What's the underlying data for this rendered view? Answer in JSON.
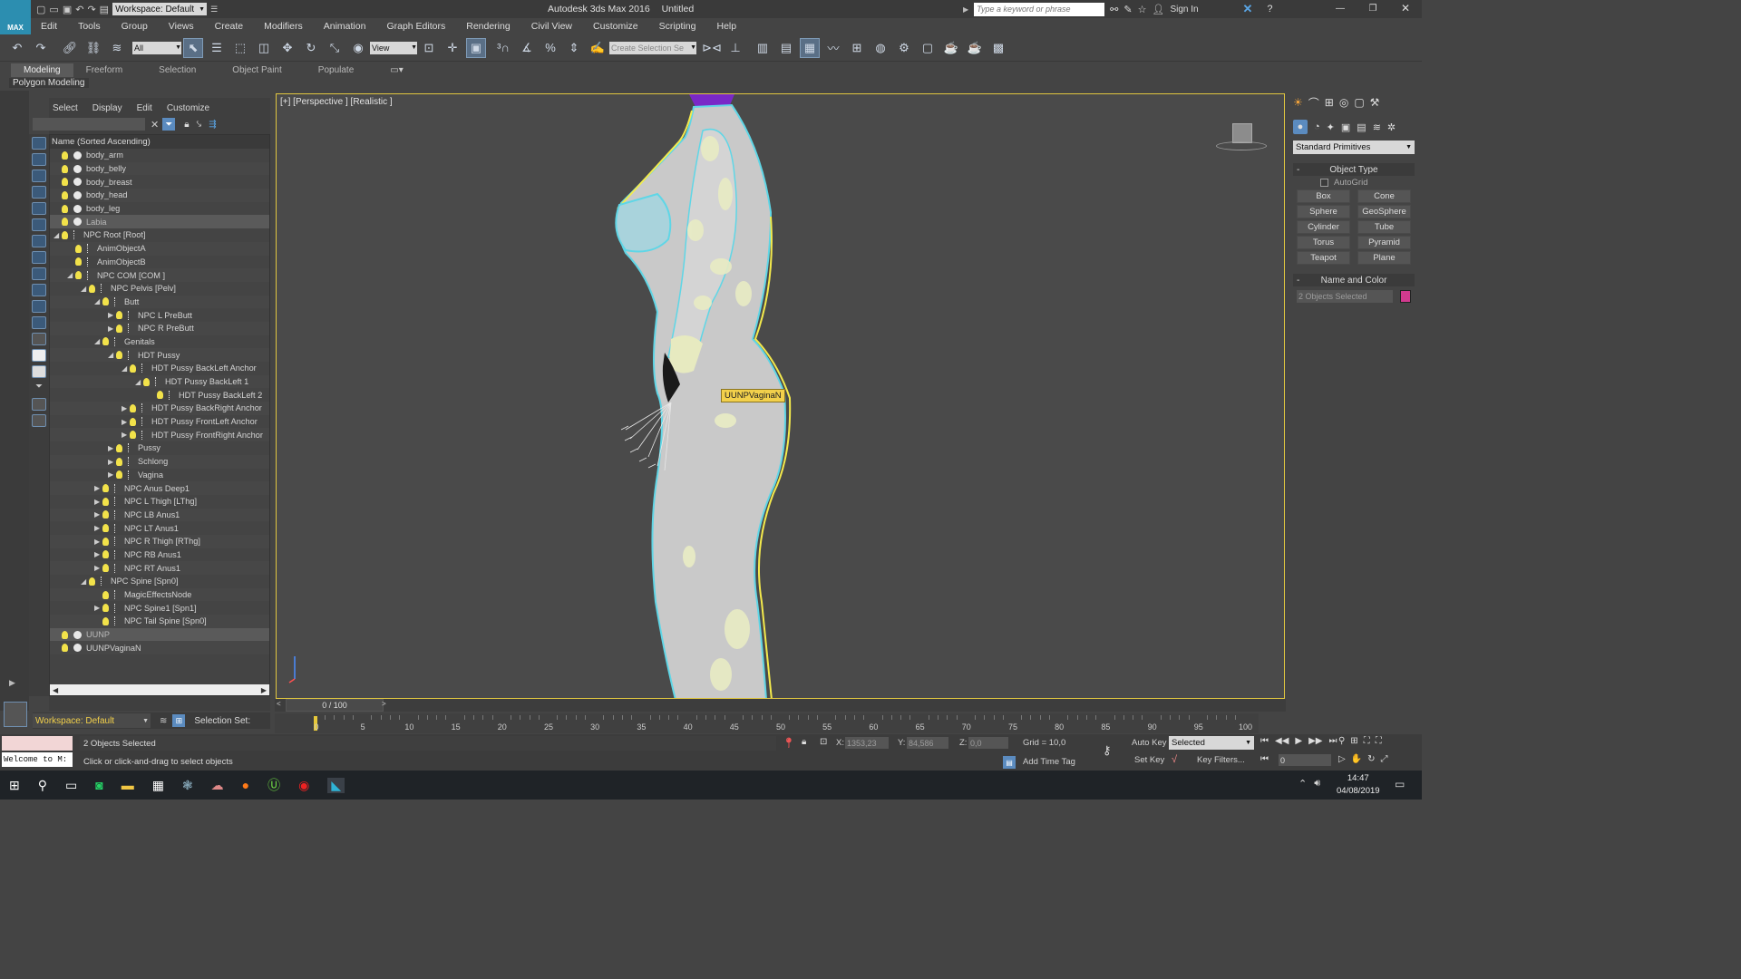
{
  "titlebar": {
    "app_logo": "MAX",
    "workspace": "Workspace: Default",
    "title": "Autodesk 3ds Max 2016",
    "document": "Untitled",
    "search_placeholder": "Type a keyword or phrase",
    "sign_in": "Sign In"
  },
  "menu": [
    "Edit",
    "Tools",
    "Group",
    "Views",
    "Create",
    "Modifiers",
    "Animation",
    "Graph Editors",
    "Rendering",
    "Civil View",
    "Customize",
    "Scripting",
    "Help"
  ],
  "toolbar": {
    "selection_filter": "All",
    "ref_coord": "View",
    "named_selection_placeholder": "Create Selection Se"
  },
  "ribbon": {
    "tabs": [
      "Modeling",
      "Freeform",
      "Selection",
      "Object Paint",
      "Populate"
    ],
    "active_tab": "Modeling",
    "panel": "Polygon Modeling"
  },
  "scene_explorer": {
    "menu": [
      "Select",
      "Display",
      "Edit",
      "Customize"
    ],
    "column_header": "Name (Sorted Ascending)",
    "rows": [
      {
        "label": "body_arm",
        "indent": 0,
        "type": "mesh",
        "expander": "",
        "selected": false
      },
      {
        "label": "body_belly",
        "indent": 0,
        "type": "mesh",
        "expander": "",
        "selected": false
      },
      {
        "label": "body_breast",
        "indent": 0,
        "type": "mesh",
        "expander": "",
        "selected": false
      },
      {
        "label": "body_head",
        "indent": 0,
        "type": "mesh",
        "expander": "",
        "selected": false
      },
      {
        "label": "body_leg",
        "indent": 0,
        "type": "mesh",
        "expander": "",
        "selected": false
      },
      {
        "label": "Labia",
        "indent": 0,
        "type": "mesh",
        "expander": "",
        "selected": true
      },
      {
        "label": "NPC Root [Root]",
        "indent": 0,
        "type": "bone",
        "expander": "open",
        "selected": false
      },
      {
        "label": "AnimObjectA",
        "indent": 1,
        "type": "bone",
        "expander": "",
        "selected": false
      },
      {
        "label": "AnimObjectB",
        "indent": 1,
        "type": "bone",
        "expander": "",
        "selected": false
      },
      {
        "label": "NPC COM [COM ]",
        "indent": 1,
        "type": "bone",
        "expander": "open",
        "selected": false
      },
      {
        "label": "NPC Pelvis [Pelv]",
        "indent": 2,
        "type": "bone",
        "expander": "open",
        "selected": false
      },
      {
        "label": "Butt",
        "indent": 3,
        "type": "bone",
        "expander": "open",
        "selected": false
      },
      {
        "label": "NPC L PreButt",
        "indent": 4,
        "type": "bone",
        "expander": "closed",
        "selected": false
      },
      {
        "label": "NPC R PreButt",
        "indent": 4,
        "type": "bone",
        "expander": "closed",
        "selected": false
      },
      {
        "label": "Genitals",
        "indent": 3,
        "type": "bone",
        "expander": "open",
        "selected": false
      },
      {
        "label": "HDT Pussy",
        "indent": 4,
        "type": "bone",
        "expander": "open",
        "selected": false
      },
      {
        "label": "HDT Pussy BackLeft Anchor",
        "indent": 5,
        "type": "bone",
        "expander": "open",
        "selected": false
      },
      {
        "label": "HDT Pussy BackLeft 1",
        "indent": 6,
        "type": "bone",
        "expander": "open",
        "selected": false
      },
      {
        "label": "HDT Pussy BackLeft 2",
        "indent": 7,
        "type": "bone",
        "expander": "",
        "selected": false
      },
      {
        "label": "HDT Pussy BackRight Anchor",
        "indent": 5,
        "type": "bone",
        "expander": "closed",
        "selected": false
      },
      {
        "label": "HDT Pussy FrontLeft Anchor",
        "indent": 5,
        "type": "bone",
        "expander": "closed",
        "selected": false
      },
      {
        "label": "HDT Pussy FrontRight Anchor",
        "indent": 5,
        "type": "bone",
        "expander": "closed",
        "selected": false
      },
      {
        "label": "Pussy",
        "indent": 4,
        "type": "bone",
        "expander": "closed",
        "selected": false
      },
      {
        "label": "Schlong",
        "indent": 4,
        "type": "bone",
        "expander": "closed",
        "selected": false
      },
      {
        "label": "Vagina",
        "indent": 4,
        "type": "bone",
        "expander": "closed",
        "selected": false
      },
      {
        "label": "NPC Anus Deep1",
        "indent": 3,
        "type": "bone",
        "expander": "closed",
        "selected": false
      },
      {
        "label": "NPC L Thigh [LThg]",
        "indent": 3,
        "type": "bone",
        "expander": "closed",
        "selected": false
      },
      {
        "label": "NPC LB Anus1",
        "indent": 3,
        "type": "bone",
        "expander": "closed",
        "selected": false
      },
      {
        "label": "NPC LT Anus1",
        "indent": 3,
        "type": "bone",
        "expander": "closed",
        "selected": false
      },
      {
        "label": "NPC R Thigh [RThg]",
        "indent": 3,
        "type": "bone",
        "expander": "closed",
        "selected": false
      },
      {
        "label": "NPC RB Anus1",
        "indent": 3,
        "type": "bone",
        "expander": "closed",
        "selected": false
      },
      {
        "label": "NPC RT Anus1",
        "indent": 3,
        "type": "bone",
        "expander": "closed",
        "selected": false
      },
      {
        "label": "NPC Spine [Spn0]",
        "indent": 2,
        "type": "bone",
        "expander": "open",
        "selected": false
      },
      {
        "label": "MagicEffectsNode",
        "indent": 3,
        "type": "bone",
        "expander": "",
        "selected": false
      },
      {
        "label": "NPC Spine1 [Spn1]",
        "indent": 3,
        "type": "bone",
        "expander": "closed",
        "selected": false
      },
      {
        "label": "NPC Tail Spine [Spn0]",
        "indent": 3,
        "type": "bone",
        "expander": "",
        "selected": false
      },
      {
        "label": "UUNP",
        "indent": 0,
        "type": "mesh",
        "expander": "",
        "selected": true
      },
      {
        "label": "UUNPVaginaN",
        "indent": 0,
        "type": "mesh",
        "expander": "",
        "selected": false
      }
    ],
    "workspace": "Workspace: Default",
    "selection_set": "Selection Set:"
  },
  "viewport": {
    "label": "[+] [Perspective ] [Realistic ]",
    "tooltip": "UUNPVaginaN"
  },
  "command_panel": {
    "category": "Standard Primitives",
    "object_type_title": "Object Type",
    "autogrid": "AutoGrid",
    "buttons": [
      "Box",
      "Cone",
      "Sphere",
      "GeoSphere",
      "Cylinder",
      "Tube",
      "Torus",
      "Pyramid",
      "Teapot",
      "Plane"
    ],
    "name_color_title": "Name and Color",
    "name_value": "2 Objects Selected",
    "object_color": "#d13a8e"
  },
  "timeline": {
    "slider": "0 / 100",
    "ticks": [
      "0",
      "5",
      "10",
      "15",
      "20",
      "25",
      "30",
      "35",
      "40",
      "45",
      "50",
      "55",
      "60",
      "65",
      "70",
      "75",
      "80",
      "85",
      "90",
      "95",
      "100"
    ]
  },
  "status": {
    "maxscript": "Welcome to M:",
    "selected": "2 Objects Selected",
    "prompt": "Click or click-and-drag to select objects",
    "x_label": "X:",
    "x": "1353,23",
    "y_label": "Y:",
    "y": "84,586",
    "z_label": "Z:",
    "z": "0,0",
    "grid": "Grid = 10,0",
    "add_time_tag": "Add Time Tag",
    "auto_key": "Auto Key",
    "key_mode": "Selected",
    "set_key": "Set Key",
    "key_filters": "Key Filters...",
    "frame": "0"
  },
  "taskbar": {
    "time": "14:47",
    "date": "04/08/2019"
  }
}
